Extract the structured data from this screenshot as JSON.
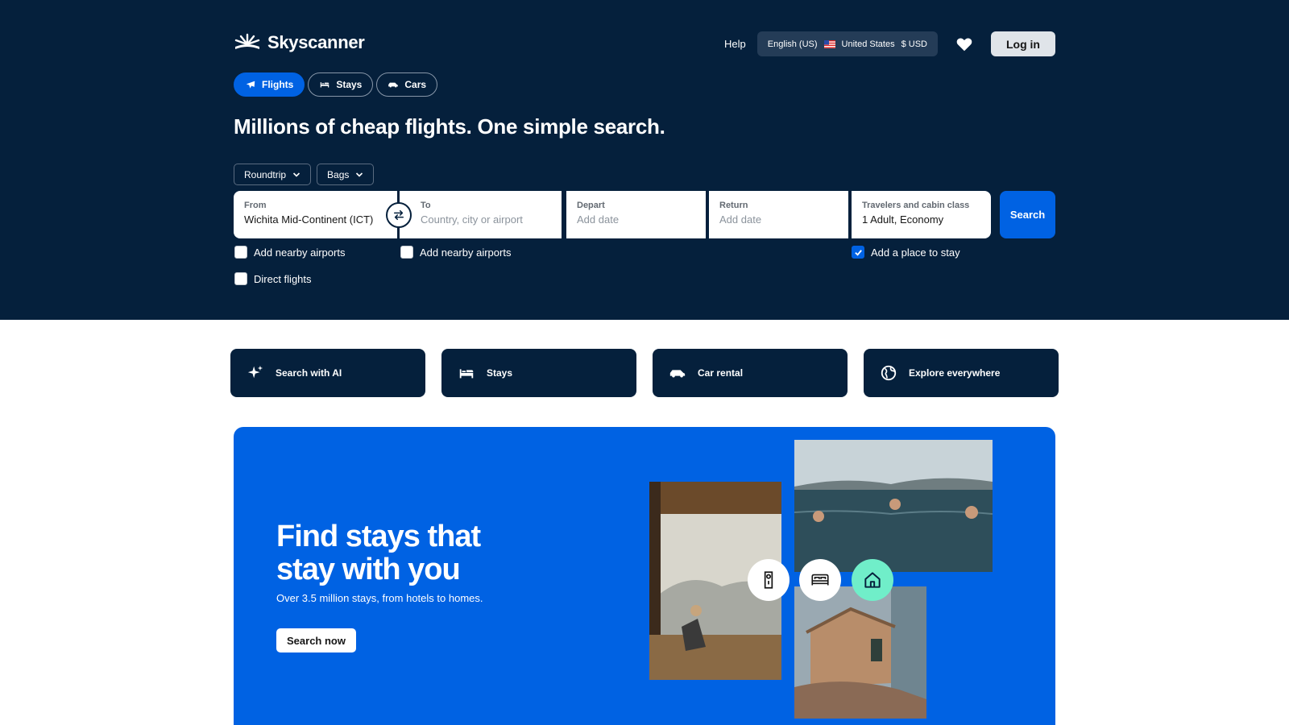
{
  "brand": {
    "name": "Skyscanner",
    "icon": "skyscanner-sun-logo"
  },
  "topnav": {
    "help": "Help",
    "language": "English (US)",
    "country": "United States",
    "currency": "$ USD",
    "login": "Log in"
  },
  "tabs": [
    {
      "label": "Flights",
      "icon": "plane-icon",
      "active": true
    },
    {
      "label": "Stays",
      "icon": "bed-icon",
      "active": false
    },
    {
      "label": "Cars",
      "icon": "car-icon",
      "active": false
    }
  ],
  "headline": "Millions of cheap flights. One simple search.",
  "options": {
    "trip_type": "Roundtrip",
    "bags": "Bags"
  },
  "search": {
    "from_label": "From",
    "from_value": "Wichita Mid-Continent (ICT)",
    "to_label": "To",
    "to_placeholder": "Country, city or airport",
    "depart_label": "Depart",
    "depart_placeholder": "Add date",
    "return_label": "Return",
    "return_placeholder": "Add date",
    "travelers_label": "Travelers and cabin class",
    "travelers_value": "1 Adult, Economy",
    "button": "Search"
  },
  "checkboxes": {
    "from_nearby": {
      "label": "Add nearby airports",
      "checked": false
    },
    "to_nearby": {
      "label": "Add nearby airports",
      "checked": false
    },
    "direct": {
      "label": "Direct flights",
      "checked": false
    },
    "place_to_stay": {
      "label": "Add a place to stay",
      "checked": true
    }
  },
  "cards": [
    {
      "label": "Search with AI",
      "icon": "sparkle-icon"
    },
    {
      "label": "Stays",
      "icon": "bed-icon"
    },
    {
      "label": "Car rental",
      "icon": "car-icon"
    },
    {
      "label": "Explore everywhere",
      "icon": "globe-icon"
    }
  ],
  "banner": {
    "title": "Find stays that stay with you",
    "subtitle": "Over 3.5 million stays, from hotels to homes.",
    "button": "Search now"
  },
  "colors": {
    "navy": "#05203c",
    "blue": "#0062e3",
    "mint": "#70eec9"
  }
}
